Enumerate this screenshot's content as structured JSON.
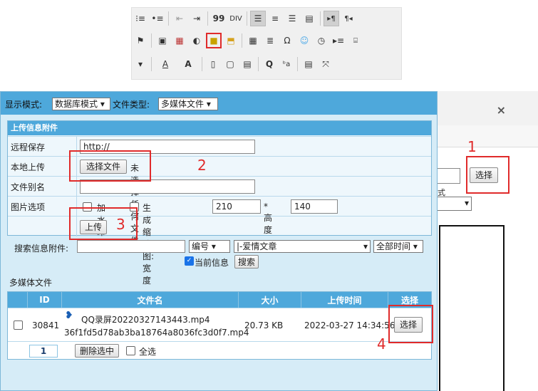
{
  "toolbar": {
    "row1": [
      "ordered-list-icon",
      "bullet-list-icon",
      "outdent-icon",
      "indent-icon",
      "blockquote-icon",
      "div-icon",
      "align-left-icon",
      "align-center-icon",
      "align-right-icon",
      "align-justify-icon",
      "ltr-icon",
      "rtl-icon"
    ],
    "row2": [
      "flag-icon",
      "image-icon",
      "flash-icon",
      "media-icon",
      "insert-media-icon",
      "upload-icon",
      "table-icon",
      "hr-icon",
      "special-char-icon",
      "smiley-icon",
      "iframe-icon",
      "pagebreak-icon",
      "code-icon"
    ],
    "row3": [
      "dropdown-icon",
      "text-color-icon",
      "bg-color-icon",
      "maximize-icon",
      "new-page-icon",
      "templates-icon",
      "find-icon",
      "replace-icon",
      "select-all-icon",
      "fullscreen-icon"
    ],
    "glyphs": {
      "quote": "99",
      "special": "Ω",
      "text_color": "A",
      "bg_color": "A",
      "find": "Q"
    }
  },
  "panel": {
    "display_mode_label": "显示模式:",
    "display_mode_value": "数据库模式",
    "file_type_label": "文件类型:",
    "file_type_value": "多媒体文件"
  },
  "upload": {
    "header": "上传信息附件",
    "remote_label": "远程保存",
    "remote_value": "http://",
    "local_label": "本地上传",
    "choose_file_button": "选择文件",
    "no_file_text": "未选择任何文件",
    "alias_label": "文件别名",
    "image_options_label": "图片选项",
    "watermark_label": "加水印",
    "thumbnail_label": "生成缩略图: 宽度",
    "width_value": "210",
    "height_label": "* 高度",
    "height_value": "140",
    "upload_button": "上传"
  },
  "search": {
    "label": "搜索信息附件:",
    "field_select": "编号",
    "category_select": "|-爱情文章",
    "time_select": "全部时间",
    "current_info_label": "当前信息",
    "search_button": "搜索"
  },
  "list": {
    "section_title": "多媒体文件",
    "columns": [
      "ID",
      "文件名",
      "大小",
      "上传时间",
      "选择"
    ],
    "rows": [
      {
        "id": "30841",
        "name": "QQ录屏20220327143443.mp4",
        "stored_name": "36f1fd5d78ab3ba18764a8036fc3d0f7.mp4",
        "size": "20.73 KB",
        "time": "2022-03-27 14:34:56",
        "select": "选择"
      }
    ],
    "page": "1",
    "delete_button": "删除选中",
    "select_all_label": "全选"
  },
  "behind_dialog": {
    "close": "×",
    "select_button": "选择",
    "partial_label": "式"
  },
  "annotations": [
    "1",
    "2",
    "3",
    "4"
  ],
  "colors": {
    "accent": "#4ea8db",
    "panel_bg": "#d6ecf7",
    "highlight": "#e02b2b"
  }
}
